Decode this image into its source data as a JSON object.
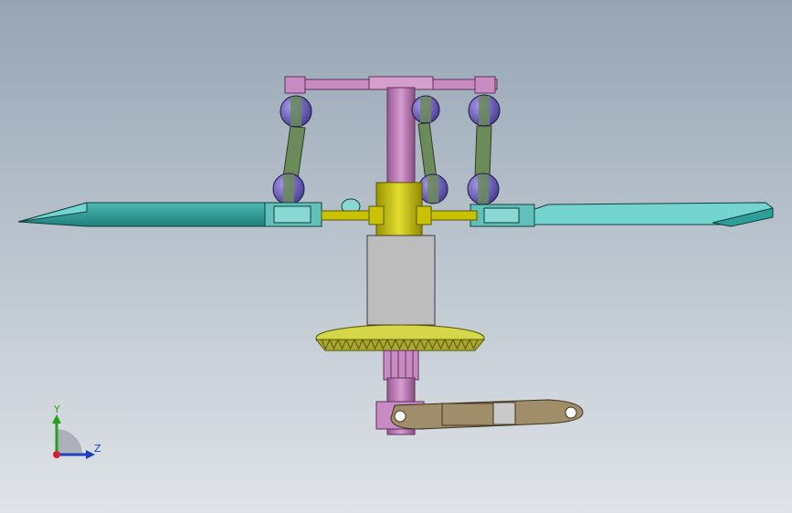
{
  "viewport": {
    "background_top": "#96a4b4",
    "background_bottom": "#dfe3e7"
  },
  "model": {
    "colors": {
      "pink": "#c98cc2",
      "pink_dark": "#8a4e86",
      "teal_blade": "#2f9d9a",
      "teal_light": "#74d4cf",
      "olive_link": "#6b8b5a",
      "ball": "#6b5cb8",
      "yellow_hub": "#c8c200",
      "gray_block": "#bdbdbd",
      "gear": "#d6d64a",
      "arm": "#a08e6a"
    }
  },
  "triad": {
    "y_label": "Y",
    "z_label": "Z",
    "y_color": "#22a020",
    "z_color": "#1d3fc0",
    "origin_color": "#d0202a"
  }
}
